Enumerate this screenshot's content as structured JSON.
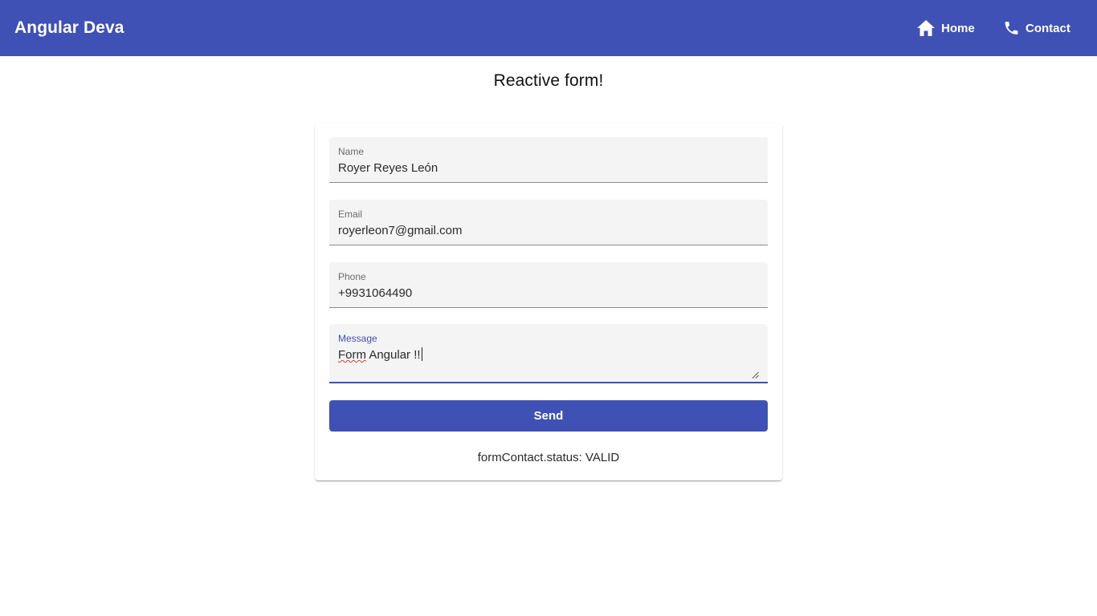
{
  "toolbar": {
    "brand": "Angular Deva",
    "nav": [
      {
        "label": "Home",
        "icon": "home-icon"
      },
      {
        "label": "Contact",
        "icon": "phone-icon"
      }
    ],
    "background_color": "#3f51b5"
  },
  "page": {
    "title": "Reactive form!"
  },
  "form": {
    "fields": {
      "name": {
        "label": "Name",
        "value": "Royer Reyes León"
      },
      "email": {
        "label": "Email",
        "value": "royerleon7@gmail.com"
      },
      "phone": {
        "label": "Phone",
        "value": "+9931064490"
      },
      "message": {
        "label": "Message",
        "value_misspelled_word": "Form",
        "value_rest": " Angular !!"
      }
    },
    "send_label": "Send",
    "status_text": "formContact.status: VALID",
    "accent_color": "#3f51b5"
  }
}
